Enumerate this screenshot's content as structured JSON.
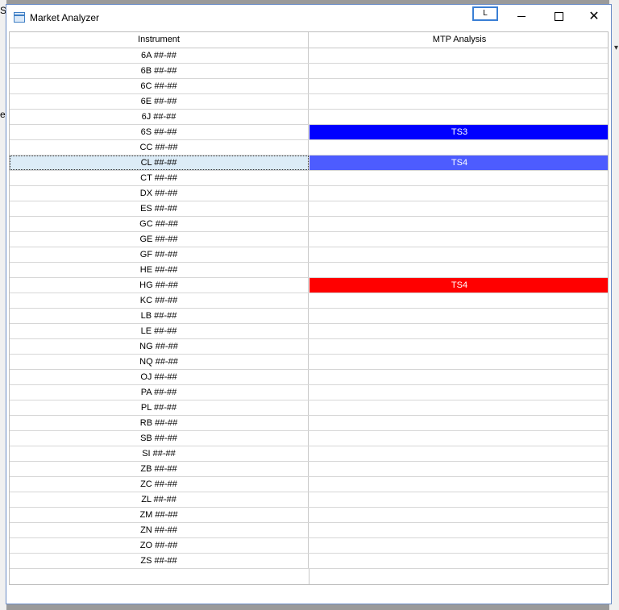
{
  "background": {
    "top_letter": "S",
    "side_letter": "e",
    "arrow_glyph": "▾"
  },
  "window": {
    "title": "Market Analyzer",
    "l_button_label": "L",
    "controls": {
      "minimize": "minimize",
      "maximize": "maximize",
      "close": "✕"
    }
  },
  "grid": {
    "columns": [
      "Instrument",
      "MTP Analysis"
    ],
    "rows": [
      {
        "instrument": "6A ##-##",
        "mtp": "",
        "color": ""
      },
      {
        "instrument": "6B ##-##",
        "mtp": "",
        "color": ""
      },
      {
        "instrument": "6C ##-##",
        "mtp": "",
        "color": ""
      },
      {
        "instrument": "6E ##-##",
        "mtp": "",
        "color": ""
      },
      {
        "instrument": "6J ##-##",
        "mtp": "",
        "color": ""
      },
      {
        "instrument": "6S ##-##",
        "mtp": "TS3",
        "color": "#0000ff"
      },
      {
        "instrument": "CC ##-##",
        "mtp": "",
        "color": ""
      },
      {
        "instrument": "CL ##-##",
        "mtp": "TS4",
        "color": "#4d5cff",
        "selected": true
      },
      {
        "instrument": "CT ##-##",
        "mtp": "",
        "color": ""
      },
      {
        "instrument": "DX ##-##",
        "mtp": "",
        "color": ""
      },
      {
        "instrument": "ES ##-##",
        "mtp": "",
        "color": ""
      },
      {
        "instrument": "GC ##-##",
        "mtp": "",
        "color": ""
      },
      {
        "instrument": "GE ##-##",
        "mtp": "",
        "color": ""
      },
      {
        "instrument": "GF ##-##",
        "mtp": "",
        "color": ""
      },
      {
        "instrument": "HE ##-##",
        "mtp": "",
        "color": ""
      },
      {
        "instrument": "HG ##-##",
        "mtp": "TS4",
        "color": "#ff0000"
      },
      {
        "instrument": "KC ##-##",
        "mtp": "",
        "color": ""
      },
      {
        "instrument": "LB ##-##",
        "mtp": "",
        "color": ""
      },
      {
        "instrument": "LE ##-##",
        "mtp": "",
        "color": ""
      },
      {
        "instrument": "NG ##-##",
        "mtp": "",
        "color": ""
      },
      {
        "instrument": "NQ ##-##",
        "mtp": "",
        "color": ""
      },
      {
        "instrument": "OJ ##-##",
        "mtp": "",
        "color": ""
      },
      {
        "instrument": "PA ##-##",
        "mtp": "",
        "color": ""
      },
      {
        "instrument": "PL ##-##",
        "mtp": "",
        "color": ""
      },
      {
        "instrument": "RB ##-##",
        "mtp": "",
        "color": ""
      },
      {
        "instrument": "SB ##-##",
        "mtp": "",
        "color": ""
      },
      {
        "instrument": "SI ##-##",
        "mtp": "",
        "color": ""
      },
      {
        "instrument": "ZB ##-##",
        "mtp": "",
        "color": ""
      },
      {
        "instrument": "ZC ##-##",
        "mtp": "",
        "color": ""
      },
      {
        "instrument": "ZL ##-##",
        "mtp": "",
        "color": ""
      },
      {
        "instrument": "ZM ##-##",
        "mtp": "",
        "color": ""
      },
      {
        "instrument": "ZN ##-##",
        "mtp": "",
        "color": ""
      },
      {
        "instrument": "ZO ##-##",
        "mtp": "",
        "color": ""
      },
      {
        "instrument": "ZS ##-##",
        "mtp": "",
        "color": ""
      }
    ]
  }
}
